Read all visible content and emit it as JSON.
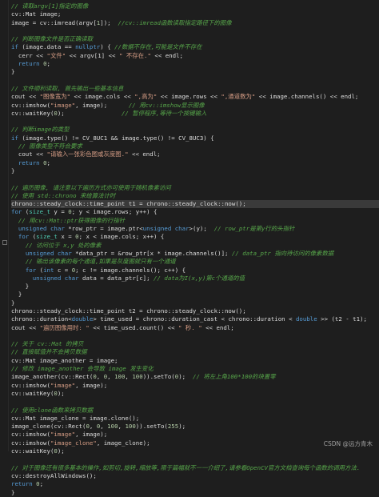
{
  "watermark": "CSDN @远方青木",
  "highlighted_line": 24,
  "code_lines": [
    [
      [
        "cm",
        "// 读取argv[1]指定的图像"
      ]
    ],
    [
      [
        "tx",
        "cv::Mat image;"
      ]
    ],
    [
      [
        "tx",
        "image = cv::imread(argv["
      ],
      [
        "num",
        "1"
      ],
      [
        "tx",
        "]);  "
      ],
      [
        "cm",
        "//cv::imread函数读取指定路径下的图像"
      ]
    ],
    [
      [
        "tx",
        ""
      ]
    ],
    [
      [
        "cm",
        "// 判断图像文件是否正确读取"
      ]
    ],
    [
      [
        "kw",
        "if"
      ],
      [
        "tx",
        " (image.data == "
      ],
      [
        "kw",
        "nullptr"
      ],
      [
        "tx",
        ") { "
      ],
      [
        "cm",
        "//数据不存在,可能是文件不存在"
      ]
    ],
    [
      [
        "tx",
        "  cerr << "
      ],
      [
        "str",
        "\"文件\""
      ],
      [
        "tx",
        " << argv[1] << "
      ],
      [
        "str",
        "\" 不存在.\""
      ],
      [
        "tx",
        " << endl;"
      ]
    ],
    [
      [
        "tx",
        "  "
      ],
      [
        "kw",
        "return"
      ],
      [
        "tx",
        " "
      ],
      [
        "num",
        "0"
      ],
      [
        "tx",
        ";"
      ]
    ],
    [
      [
        "tx",
        "}"
      ]
    ],
    [
      [
        "tx",
        ""
      ]
    ],
    [
      [
        "cm",
        "// 文件顺利读取, 首先输出一些基本信息"
      ]
    ],
    [
      [
        "tx",
        "cout << "
      ],
      [
        "str",
        "\"图像宽为\""
      ],
      [
        "tx",
        " << image.cols << "
      ],
      [
        "str",
        "\",高为\""
      ],
      [
        "tx",
        " << image.rows << "
      ],
      [
        "str",
        "\",通道数为\""
      ],
      [
        "tx",
        " << image.channels() << endl;"
      ]
    ],
    [
      [
        "tx",
        "cv::imshow("
      ],
      [
        "str",
        "\"image\""
      ],
      [
        "tx",
        ", image);      "
      ],
      [
        "cm",
        "// 用cv::imshow显示图像"
      ]
    ],
    [
      [
        "tx",
        "cv::waitKey("
      ],
      [
        "num",
        "0"
      ],
      [
        "tx",
        ");                "
      ],
      [
        "cm",
        "// 暂停程序,等待一个按键输入"
      ]
    ],
    [
      [
        "tx",
        ""
      ]
    ],
    [
      [
        "cm",
        "// 判断image的类型"
      ]
    ],
    [
      [
        "kw",
        "if"
      ],
      [
        "tx",
        " (image.type() != CV_8UC1 && image.type() != CV_8UC3) {"
      ]
    ],
    [
      [
        "tx",
        "  "
      ],
      [
        "cm",
        "// 图像类型不符合要求"
      ]
    ],
    [
      [
        "tx",
        "  cout << "
      ],
      [
        "str",
        "\"请输入一张彩色图或灰度图.\""
      ],
      [
        "tx",
        " << endl;"
      ]
    ],
    [
      [
        "tx",
        "  "
      ],
      [
        "kw",
        "return"
      ],
      [
        "tx",
        " "
      ],
      [
        "num",
        "0"
      ],
      [
        "tx",
        ";"
      ]
    ],
    [
      [
        "tx",
        "}"
      ]
    ],
    [
      [
        "tx",
        ""
      ]
    ],
    [
      [
        "cm",
        "// 遍历图像, 请注意以下遍历方式亦可使用于随机像素访问"
      ]
    ],
    [
      [
        "cm",
        "// 使用 std::chrono 来给算法计时"
      ]
    ],
    [
      [
        "tx",
        "chrono::steady_clock::time_point t1 = chrono::steady_clock::now();"
      ]
    ],
    [
      [
        "kw",
        "for"
      ],
      [
        "tx",
        " ("
      ],
      [
        "ty",
        "size_t"
      ],
      [
        "tx",
        " y = "
      ],
      [
        "num",
        "0"
      ],
      [
        "tx",
        "; y < image.rows; y++) {"
      ]
    ],
    [
      [
        "tx",
        "  "
      ],
      [
        "cm",
        "// 用cv::Mat::ptr获得图像的行指针"
      ]
    ],
    [
      [
        "tx",
        "  "
      ],
      [
        "kw",
        "unsigned"
      ],
      [
        "tx",
        " "
      ],
      [
        "kw",
        "char"
      ],
      [
        "tx",
        " *row_ptr = image.ptr<"
      ],
      [
        "kw",
        "unsigned"
      ],
      [
        "tx",
        " "
      ],
      [
        "kw",
        "char"
      ],
      [
        "tx",
        ">(y);  "
      ],
      [
        "cm",
        "// row_ptr是第y行的头指针"
      ]
    ],
    [
      [
        "tx",
        "  "
      ],
      [
        "kw",
        "for"
      ],
      [
        "tx",
        " ("
      ],
      [
        "ty",
        "size_t"
      ],
      [
        "tx",
        " x = "
      ],
      [
        "num",
        "0"
      ],
      [
        "tx",
        "; x < image.cols; x++) {"
      ]
    ],
    [
      [
        "tx",
        "    "
      ],
      [
        "cm",
        "// 访问位于 x,y 处的像素"
      ]
    ],
    [
      [
        "tx",
        "    "
      ],
      [
        "kw",
        "unsigned"
      ],
      [
        "tx",
        " "
      ],
      [
        "kw",
        "char"
      ],
      [
        "tx",
        " *data_ptr = &row_ptr[x * image.channels()]; "
      ],
      [
        "cm",
        "// data_ptr 指向待访问的像素数据"
      ]
    ],
    [
      [
        "tx",
        "    "
      ],
      [
        "cm",
        "// 输出该像素的每个通道,如果是灰度图就只有一个通道"
      ]
    ],
    [
      [
        "tx",
        "    "
      ],
      [
        "kw",
        "for"
      ],
      [
        "tx",
        " ("
      ],
      [
        "kw",
        "int"
      ],
      [
        "tx",
        " c = "
      ],
      [
        "num",
        "0"
      ],
      [
        "tx",
        "; c != image.channels(); c++) {"
      ]
    ],
    [
      [
        "tx",
        "      "
      ],
      [
        "kw",
        "unsigned"
      ],
      [
        "tx",
        " "
      ],
      [
        "kw",
        "char"
      ],
      [
        "tx",
        " data = data_ptr[c]; "
      ],
      [
        "cm",
        "// data为I(x,y)第c个通道的值"
      ]
    ],
    [
      [
        "tx",
        "    }"
      ]
    ],
    [
      [
        "tx",
        "  }"
      ]
    ],
    [
      [
        "tx",
        "}"
      ]
    ],
    [
      [
        "tx",
        "chrono::steady_clock::time_point t2 = chrono::steady_clock::now();"
      ]
    ],
    [
      [
        "tx",
        "chrono::duration<"
      ],
      [
        "kw",
        "double"
      ],
      [
        "tx",
        "> time_used = chrono::duration_cast < chrono::duration < "
      ],
      [
        "kw",
        "double"
      ],
      [
        "tx",
        " >> (t2 - t1);"
      ]
    ],
    [
      [
        "tx",
        "cout << "
      ],
      [
        "str",
        "\"遍历图像用时: \""
      ],
      [
        "tx",
        " << time_used.count() << "
      ],
      [
        "str",
        "\" 秒. \""
      ],
      [
        "tx",
        " << endl;"
      ]
    ],
    [
      [
        "tx",
        ""
      ]
    ],
    [
      [
        "cm",
        "// 关于 cv::Mat 的拷贝"
      ]
    ],
    [
      [
        "cm",
        "// 直接赋值并不会拷贝数据"
      ]
    ],
    [
      [
        "tx",
        "cv::Mat image_another = image;"
      ]
    ],
    [
      [
        "cm",
        "// 修改 image_another 会导致 image 发生变化"
      ]
    ],
    [
      [
        "tx",
        "image_another(cv::Rect("
      ],
      [
        "num",
        "0"
      ],
      [
        "tx",
        ", "
      ],
      [
        "num",
        "0"
      ],
      [
        "tx",
        ", "
      ],
      [
        "num",
        "100"
      ],
      [
        "tx",
        ", "
      ],
      [
        "num",
        "100"
      ],
      [
        "tx",
        ")).setTo("
      ],
      [
        "num",
        "0"
      ],
      [
        "tx",
        ");  "
      ],
      [
        "cm",
        "// 将左上角100*100的块置零"
      ]
    ],
    [
      [
        "tx",
        "cv::imshow("
      ],
      [
        "str",
        "\"image\""
      ],
      [
        "tx",
        ", image);"
      ]
    ],
    [
      [
        "tx",
        "cv::waitKey("
      ],
      [
        "num",
        "0"
      ],
      [
        "tx",
        ");"
      ]
    ],
    [
      [
        "tx",
        ""
      ]
    ],
    [
      [
        "cm",
        "// 使用clone函数来拷贝数据"
      ]
    ],
    [
      [
        "tx",
        "cv::Mat image_clone = image.clone();"
      ]
    ],
    [
      [
        "tx",
        "image_clone(cv::Rect("
      ],
      [
        "num",
        "0"
      ],
      [
        "tx",
        ", "
      ],
      [
        "num",
        "0"
      ],
      [
        "tx",
        ", "
      ],
      [
        "num",
        "100"
      ],
      [
        "tx",
        ", "
      ],
      [
        "num",
        "100"
      ],
      [
        "tx",
        ")).setTo("
      ],
      [
        "num",
        "255"
      ],
      [
        "tx",
        ");"
      ]
    ],
    [
      [
        "tx",
        "cv::imshow("
      ],
      [
        "str",
        "\"image\""
      ],
      [
        "tx",
        ", image);"
      ]
    ],
    [
      [
        "tx",
        "cv::imshow("
      ],
      [
        "str",
        "\"image_clone\""
      ],
      [
        "tx",
        ", image_clone);"
      ]
    ],
    [
      [
        "tx",
        "cv::waitKey("
      ],
      [
        "num",
        "0"
      ],
      [
        "tx",
        ");"
      ]
    ],
    [
      [
        "tx",
        ""
      ]
    ],
    [
      [
        "cm",
        "// 对于图像还有很多基本的操作,如剪切,旋转,缩放等,限于篇幅就不一一介绍了,请参看OpenCV官方文档查询每个函数的调用方法."
      ]
    ],
    [
      [
        "tx",
        "cv::destroyAllWindows();"
      ]
    ],
    [
      [
        "kw",
        "return"
      ],
      [
        "tx",
        " "
      ],
      [
        "num",
        "0"
      ],
      [
        "tx",
        ";"
      ]
    ],
    [
      [
        "tx",
        "}"
      ]
    ]
  ]
}
